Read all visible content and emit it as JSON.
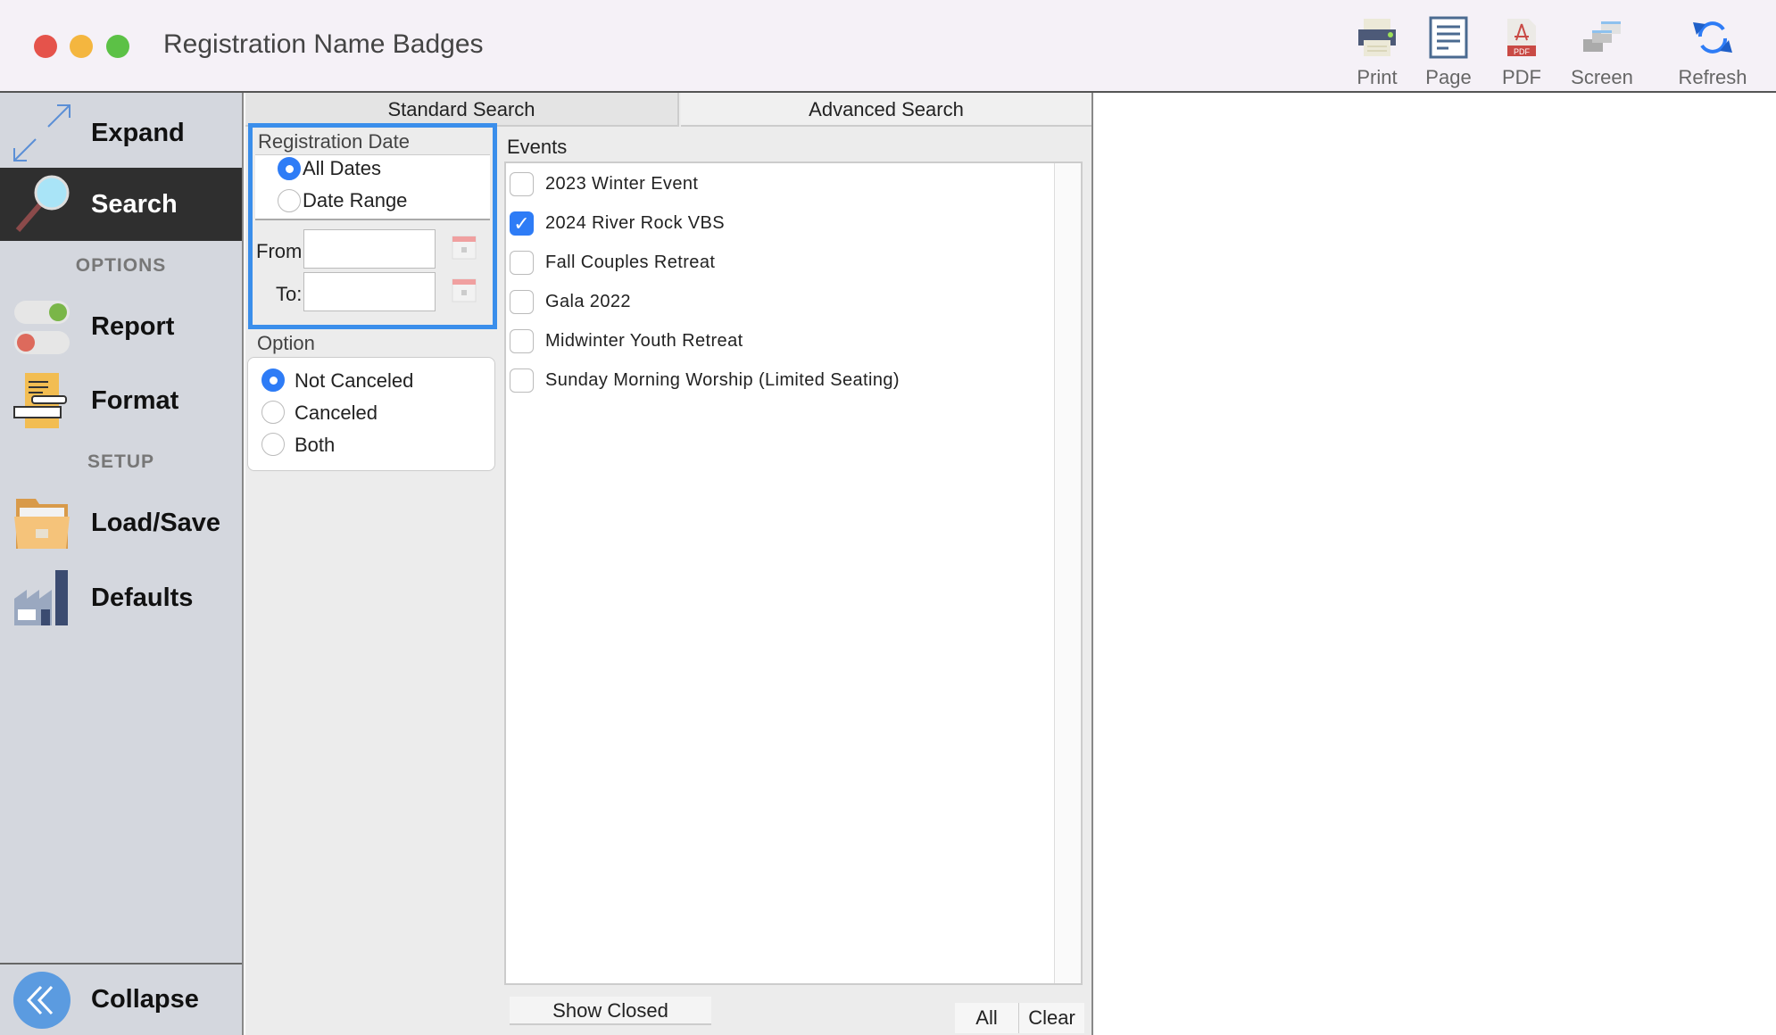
{
  "window": {
    "title": "Registration Name Badges",
    "traffic_lights": [
      "#e5534b",
      "#f4b63f",
      "#5cc146"
    ]
  },
  "toolbar": [
    {
      "label": "Print",
      "icon": "printer-icon"
    },
    {
      "label": "Page",
      "icon": "page-icon"
    },
    {
      "label": "PDF",
      "icon": "pdf-icon"
    },
    {
      "label": "Screen",
      "icon": "screen-icon"
    },
    {
      "label": "Refresh",
      "icon": "refresh-icon"
    }
  ],
  "sidebar": {
    "expand": "Expand",
    "search": "Search",
    "options_header": "OPTIONS",
    "report": "Report",
    "format": "Format",
    "setup_header": "SETUP",
    "load_save": "Load/Save",
    "defaults": "Defaults",
    "collapse": "Collapse",
    "active": "Search"
  },
  "tabs": {
    "standard": "Standard Search",
    "advanced": "Advanced Search",
    "active": "Standard Search"
  },
  "registration_date": {
    "label": "Registration Date",
    "options": [
      "All Dates",
      "Date Range"
    ],
    "selected": "All Dates",
    "from_label": "From:",
    "to_label": "To:",
    "from_value": "",
    "to_value": ""
  },
  "option": {
    "label": "Option",
    "choices": [
      "Not Canceled",
      "Canceled",
      "Both"
    ],
    "selected": "Not Canceled"
  },
  "events": {
    "label": "Events",
    "items": [
      {
        "name": "2023 Winter Event",
        "checked": false
      },
      {
        "name": "2024 River Rock VBS",
        "checked": true
      },
      {
        "name": "Fall Couples Retreat",
        "checked": false
      },
      {
        "name": "Gala 2022",
        "checked": false
      },
      {
        "name": "Midwinter Youth Retreat",
        "checked": false
      },
      {
        "name": "Sunday Morning Worship (Limited Seating)",
        "checked": false
      }
    ]
  },
  "buttons": {
    "show_closed": "Show Closed",
    "all": "All",
    "clear": "Clear"
  },
  "colors": {
    "accent": "#2e7cf6",
    "sidebar_active": "#2f2f2f",
    "sidebar_bg": "#d4d7de"
  }
}
